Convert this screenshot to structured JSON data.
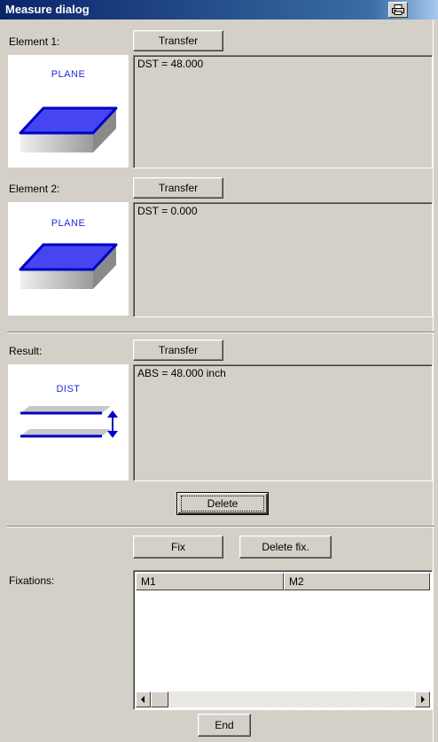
{
  "window": {
    "title": "Measure dialog",
    "sys_icon": "printer-icon"
  },
  "element1": {
    "label": "Element 1:",
    "transfer_label": "Transfer",
    "preview_text": "PLANE",
    "output": "DST = 48.000"
  },
  "element2": {
    "label": "Element 2:",
    "transfer_label": "Transfer",
    "preview_text": "PLANE",
    "output": "DST = 0.000"
  },
  "result": {
    "label": "Result:",
    "transfer_label": "Transfer",
    "preview_text": "DIST",
    "output": "ABS = 48.000 inch",
    "delete_label": "Delete"
  },
  "fixations": {
    "fix_label": "Fix",
    "delete_fix_label": "Delete fix.",
    "label": "Fixations:",
    "columns": [
      "M1",
      "M2"
    ],
    "rows": []
  },
  "footer": {
    "end_label": "End"
  },
  "colors": {
    "title_bar": "#0a246a",
    "dialog_bg": "#d4d0c8",
    "plane_fill": "#4a4af0",
    "icon_blue": "#1f2bd8"
  }
}
